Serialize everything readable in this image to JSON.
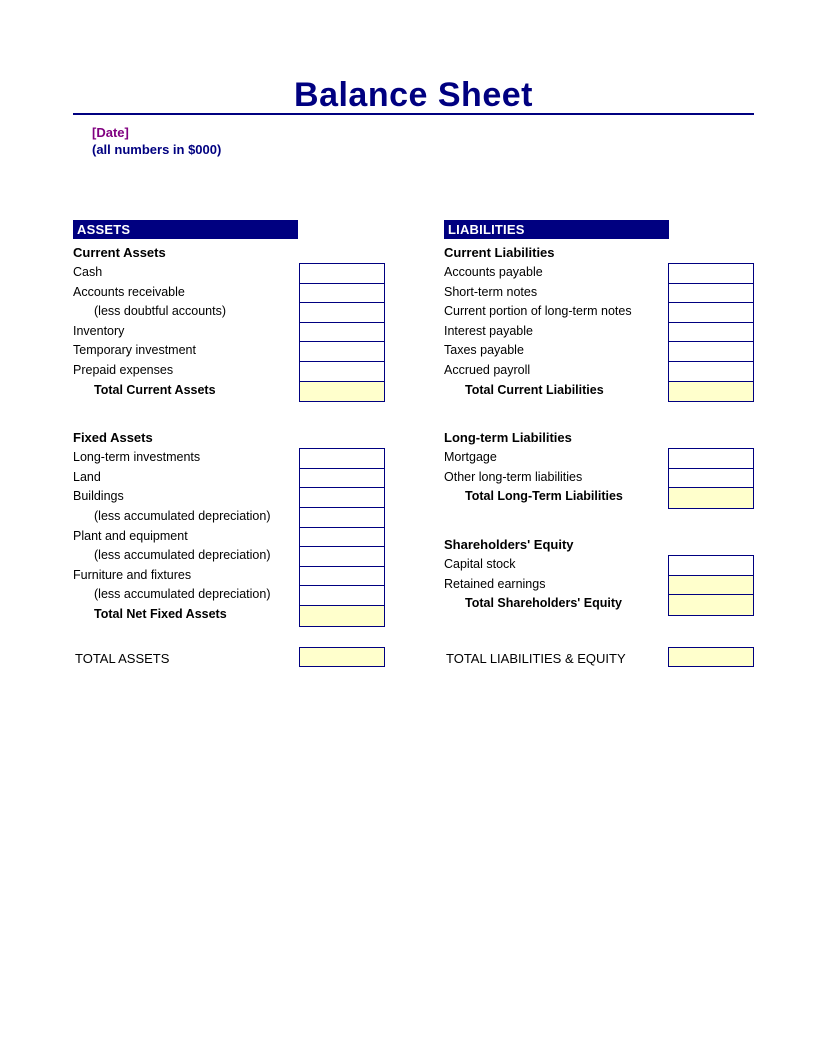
{
  "document": {
    "title": "Balance Sheet",
    "date_placeholder": "[Date]",
    "units_note": "(all numbers in $000)"
  },
  "colors": {
    "header_bar": "#000080",
    "header_text": "#FFFFFF",
    "title_text": "#000080",
    "date_text": "#800080",
    "box_border": "#000080",
    "total_fill": "#FFFFCC"
  },
  "assets": {
    "header": "ASSETS",
    "groups": [
      {
        "title": "Current Assets",
        "rows": [
          {
            "label": "Cash",
            "indent": false,
            "value": "",
            "fill": "white"
          },
          {
            "label": "Accounts receivable",
            "indent": false,
            "value": "",
            "fill": "white"
          },
          {
            "label": "(less doubtful accounts)",
            "indent": true,
            "value": "",
            "fill": "white"
          },
          {
            "label": "Inventory",
            "indent": false,
            "value": "",
            "fill": "white"
          },
          {
            "label": "Temporary investment",
            "indent": false,
            "value": "",
            "fill": "white"
          },
          {
            "label": "Prepaid expenses",
            "indent": false,
            "value": "",
            "fill": "white"
          },
          {
            "label": "Total Current Assets",
            "indent": true,
            "total": true,
            "value": "",
            "fill": "yellow"
          }
        ]
      },
      {
        "title": "Fixed Assets",
        "rows": [
          {
            "label": "Long-term investments",
            "indent": false,
            "value": "",
            "fill": "white"
          },
          {
            "label": "Land",
            "indent": false,
            "value": "",
            "fill": "white"
          },
          {
            "label": "Buildings",
            "indent": false,
            "value": "",
            "fill": "white"
          },
          {
            "label": "(less accumulated depreciation)",
            "indent": true,
            "value": "",
            "fill": "white"
          },
          {
            "label": "Plant and equipment",
            "indent": false,
            "value": "",
            "fill": "white"
          },
          {
            "label": "(less accumulated depreciation)",
            "indent": true,
            "value": "",
            "fill": "white"
          },
          {
            "label": "Furniture and fixtures",
            "indent": false,
            "value": "",
            "fill": "white"
          },
          {
            "label": "(less accumulated depreciation)",
            "indent": true,
            "value": "",
            "fill": "white"
          },
          {
            "label": "Total Net Fixed Assets",
            "indent": true,
            "total": true,
            "value": "",
            "fill": "yellow"
          }
        ]
      }
    ],
    "grand_total_label": "TOTAL ASSETS",
    "grand_total_value": ""
  },
  "liabilities": {
    "header": "LIABILITIES",
    "groups": [
      {
        "title": "Current Liabilities",
        "rows": [
          {
            "label": "Accounts payable",
            "indent": false,
            "value": "",
            "fill": "white"
          },
          {
            "label": "Short-term notes",
            "indent": false,
            "value": "",
            "fill": "white"
          },
          {
            "label": "Current portion of long-term notes",
            "indent": false,
            "value": "",
            "fill": "white"
          },
          {
            "label": "Interest payable",
            "indent": false,
            "value": "",
            "fill": "white"
          },
          {
            "label": "Taxes payable",
            "indent": false,
            "value": "",
            "fill": "white"
          },
          {
            "label": "Accrued payroll",
            "indent": false,
            "value": "",
            "fill": "white"
          },
          {
            "label": "Total Current Liabilities",
            "indent": true,
            "total": true,
            "value": "",
            "fill": "yellow"
          }
        ]
      },
      {
        "title": "Long-term Liabilities",
        "rows": [
          {
            "label": "Mortgage",
            "indent": false,
            "value": "",
            "fill": "white"
          },
          {
            "label": "Other long-term liabilities",
            "indent": false,
            "value": "",
            "fill": "white"
          },
          {
            "label": "Total Long-Term Liabilities",
            "indent": true,
            "total": true,
            "value": "",
            "fill": "yellow"
          }
        ]
      },
      {
        "title": "Shareholders' Equity",
        "rows": [
          {
            "label": "Capital stock",
            "indent": false,
            "value": "",
            "fill": "white"
          },
          {
            "label": "Retained earnings",
            "indent": false,
            "value": "",
            "fill": "yellow"
          },
          {
            "label": "Total Shareholders' Equity",
            "indent": true,
            "total": true,
            "value": "",
            "fill": "yellow"
          }
        ]
      }
    ],
    "grand_total_label": "TOTAL LIABILITIES & EQUITY",
    "grand_total_value": ""
  }
}
